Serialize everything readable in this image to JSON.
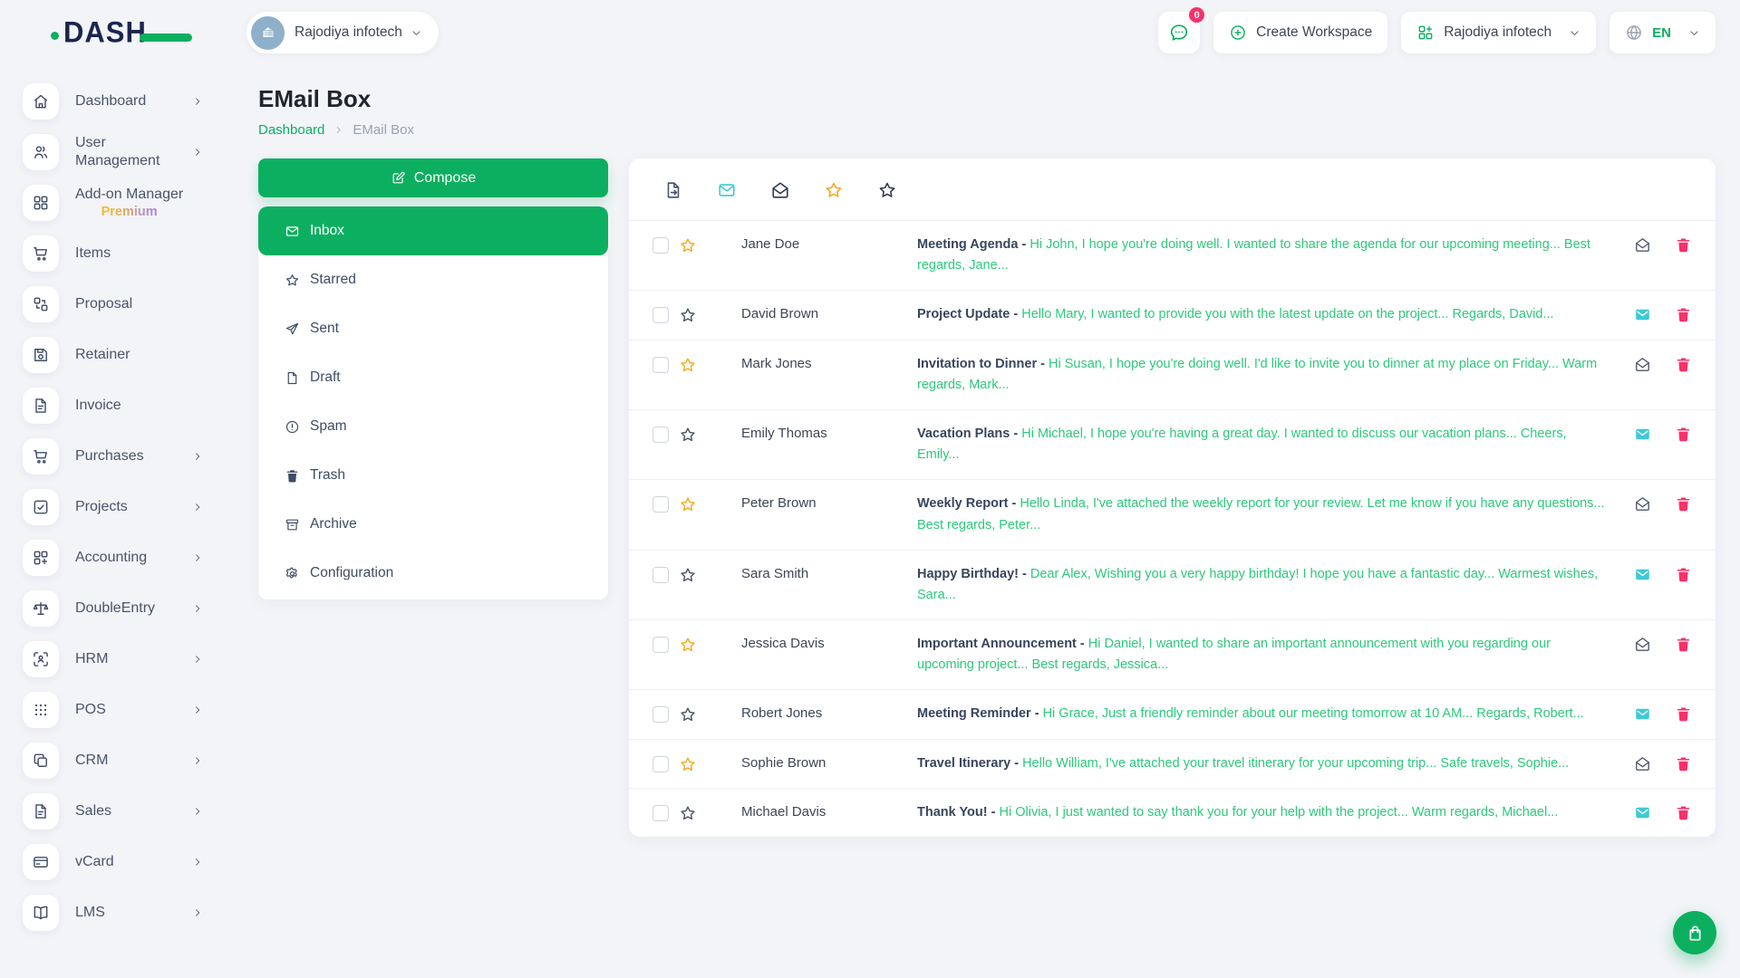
{
  "colors": {
    "accent": "#0CAF60",
    "danger": "#f7316a",
    "info": "#3EC9D6",
    "warning": "#F6A723"
  },
  "brand": {
    "name": "DASH"
  },
  "header": {
    "workspace_selector": "Rajodiya infotech",
    "messages_badge": "0",
    "create_workspace_label": "Create Workspace",
    "company_selector": "Rajodiya infotech",
    "language_label": "EN"
  },
  "sidebar": {
    "items": [
      {
        "label": "Dashboard",
        "icon": "home",
        "has_children": true
      },
      {
        "label": "User Management",
        "icon": "users",
        "has_children": true
      },
      {
        "label": "Add-on Manager",
        "sublabel": "Premium",
        "icon": "grid",
        "has_children": false
      },
      {
        "label": "Items",
        "icon": "cart",
        "has_children": false
      },
      {
        "label": "Proposal",
        "icon": "swap-grid",
        "has_children": false
      },
      {
        "label": "Retainer",
        "icon": "floppy",
        "has_children": false
      },
      {
        "label": "Invoice",
        "icon": "file-lines",
        "has_children": false
      },
      {
        "label": "Purchases",
        "icon": "cart",
        "has_children": true
      },
      {
        "label": "Projects",
        "icon": "check-square",
        "has_children": true
      },
      {
        "label": "Accounting",
        "icon": "grid-plus",
        "has_children": true
      },
      {
        "label": "DoubleEntry",
        "icon": "scales",
        "has_children": true
      },
      {
        "label": "HRM",
        "icon": "user-scan",
        "has_children": true
      },
      {
        "label": "POS",
        "icon": "dots",
        "has_children": true
      },
      {
        "label": "CRM",
        "icon": "copy",
        "has_children": true
      },
      {
        "label": "Sales",
        "icon": "file-lines",
        "has_children": true
      },
      {
        "label": "vCard",
        "icon": "card",
        "has_children": true
      },
      {
        "label": "LMS",
        "icon": "book",
        "has_children": true
      }
    ]
  },
  "page": {
    "title": "EMail Box",
    "breadcrumb": {
      "link": "Dashboard",
      "current": "EMail Box"
    }
  },
  "mailbox": {
    "compose_label": "Compose",
    "folders": [
      {
        "label": "Inbox",
        "icon": "mail",
        "active": true
      },
      {
        "label": "Starred",
        "icon": "star",
        "active": false
      },
      {
        "label": "Sent",
        "icon": "send",
        "active": false
      },
      {
        "label": "Draft",
        "icon": "file-blank",
        "active": false
      },
      {
        "label": "Spam",
        "icon": "alert-circle",
        "active": false
      },
      {
        "label": "Trash",
        "icon": "trash",
        "active": false
      },
      {
        "label": "Archive",
        "icon": "archive",
        "active": false
      },
      {
        "label": "Configuration",
        "icon": "gear",
        "active": false
      }
    ],
    "toolbar": [
      {
        "icon": "file-export",
        "color": "#44506a"
      },
      {
        "icon": "mail",
        "color": "#3EC9D6"
      },
      {
        "icon": "mail-open",
        "color": "#2b3950"
      },
      {
        "icon": "star",
        "color": "#F6A723"
      },
      {
        "icon": "star",
        "color": "#2b3950"
      }
    ],
    "emails": [
      {
        "sender": "Jane Doe",
        "starred": true,
        "unread": false,
        "subject": "Meeting Agenda -",
        "preview": "Hi John, I hope you're doing well. I wanted to share the agenda for our upcoming meeting... Best regards, Jane..."
      },
      {
        "sender": "David Brown",
        "starred": false,
        "unread": true,
        "subject": "Project Update -",
        "preview": "Hello Mary, I wanted to provide you with the latest update on the project... Regards, David..."
      },
      {
        "sender": "Mark Jones",
        "starred": true,
        "unread": false,
        "subject": "Invitation to Dinner -",
        "preview": "Hi Susan, I hope you're doing well. I'd like to invite you to dinner at my place on Friday... Warm regards, Mark..."
      },
      {
        "sender": "Emily Thomas",
        "starred": false,
        "unread": true,
        "subject": "Vacation Plans -",
        "preview": "Hi Michael, I hope you're having a great day. I wanted to discuss our vacation plans... Cheers, Emily..."
      },
      {
        "sender": "Peter Brown",
        "starred": true,
        "unread": false,
        "subject": "Weekly Report -",
        "preview": "Hello Linda, I've attached the weekly report for your review. Let me know if you have any questions... Best regards, Peter..."
      },
      {
        "sender": "Sara Smith",
        "starred": false,
        "unread": true,
        "subject": "Happy Birthday! -",
        "preview": "Dear Alex, Wishing you a very happy birthday! I hope you have a fantastic day... Warmest wishes, Sara..."
      },
      {
        "sender": "Jessica Davis",
        "starred": true,
        "unread": false,
        "subject": "Important Announcement -",
        "preview": "Hi Daniel, I wanted to share an important announcement with you regarding our upcoming project... Best regards, Jessica..."
      },
      {
        "sender": "Robert Jones",
        "starred": false,
        "unread": true,
        "subject": "Meeting Reminder -",
        "preview": "Hi Grace, Just a friendly reminder about our meeting tomorrow at 10 AM... Regards, Robert..."
      },
      {
        "sender": "Sophie Brown",
        "starred": true,
        "unread": false,
        "subject": "Travel Itinerary -",
        "preview": "Hello William, I've attached your travel itinerary for your upcoming trip... Safe travels, Sophie..."
      },
      {
        "sender": "Michael Davis",
        "starred": false,
        "unread": true,
        "subject": "Thank You! -",
        "preview": "Hi Olivia, I just wanted to say thank you for your help with the project... Warm regards, Michael..."
      }
    ]
  }
}
